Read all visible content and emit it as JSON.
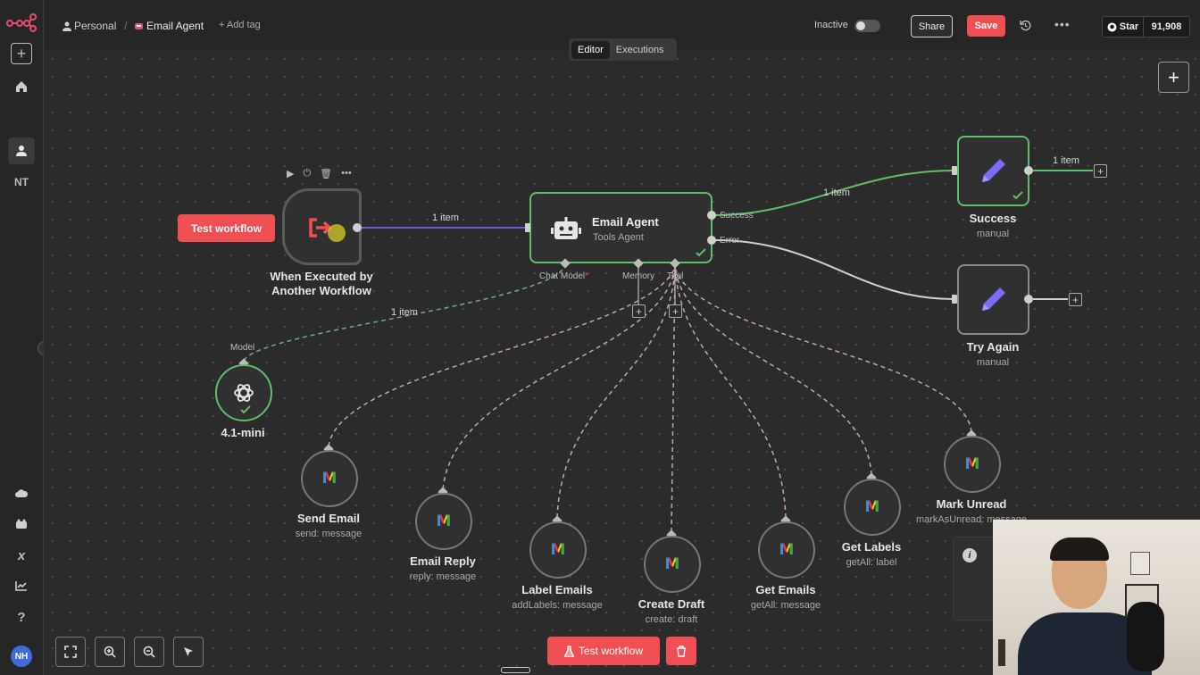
{
  "header": {
    "breadcrumb_owner": "Personal",
    "workflow_name": "Email Agent",
    "add_tag": "+ Add tag",
    "status": "Inactive",
    "share": "Share",
    "save": "Save",
    "github_star": "Star",
    "github_count": "91,908"
  },
  "tabs": [
    {
      "label": "Editor",
      "active": true
    },
    {
      "label": "Executions",
      "active": false
    }
  ],
  "sidebar": {
    "items": [
      "plus-icon",
      "home-icon",
      "user-icon",
      "NT",
      "cloud-icon",
      "templates-icon",
      "variables-icon",
      "insights-icon",
      "help-icon"
    ],
    "project_initials": "NT",
    "avatar_initials": "NH"
  },
  "nodes": {
    "trigger": {
      "title": "When Executed by",
      "title2": "Another Workflow"
    },
    "agent": {
      "title": "Email Agent",
      "subtitle": "Tools Agent",
      "ports": {
        "chat_model": "Chat Model",
        "required": "*",
        "memory": "Memory",
        "tool": "Tool",
        "success": "Success",
        "error": "Error"
      }
    },
    "success": {
      "title": "Success",
      "subtitle": "manual"
    },
    "try_again": {
      "title": "Try Again",
      "subtitle": "manual"
    },
    "model": {
      "title": "4.1-mini",
      "port": "Model"
    },
    "tools": [
      {
        "title": "Send Email",
        "subtitle": "send: message"
      },
      {
        "title": "Email Reply",
        "subtitle": "reply: message"
      },
      {
        "title": "Label Emails",
        "subtitle": "addLabels: message"
      },
      {
        "title": "Create Draft",
        "subtitle": "create: draft"
      },
      {
        "title": "Get Emails",
        "subtitle": "getAll: message"
      },
      {
        "title": "Get Labels",
        "subtitle": "getAll: label"
      },
      {
        "title": "Mark Unread",
        "subtitle": "markAsUnread: message"
      }
    ]
  },
  "edges": {
    "trigger_to_agent": "1 item",
    "agent_to_success": "1 item",
    "success_out": "1 item",
    "model_to_agent": "1 item"
  },
  "buttons": {
    "test_workflow": "Test workflow",
    "test_workflow_bottom": "Test workflow"
  },
  "colors": {
    "accent_red": "#ef4f52",
    "success_green": "#5fbd6c",
    "canvas_bg": "#2b2b2b",
    "edit_purple": "#7b6cf6"
  }
}
